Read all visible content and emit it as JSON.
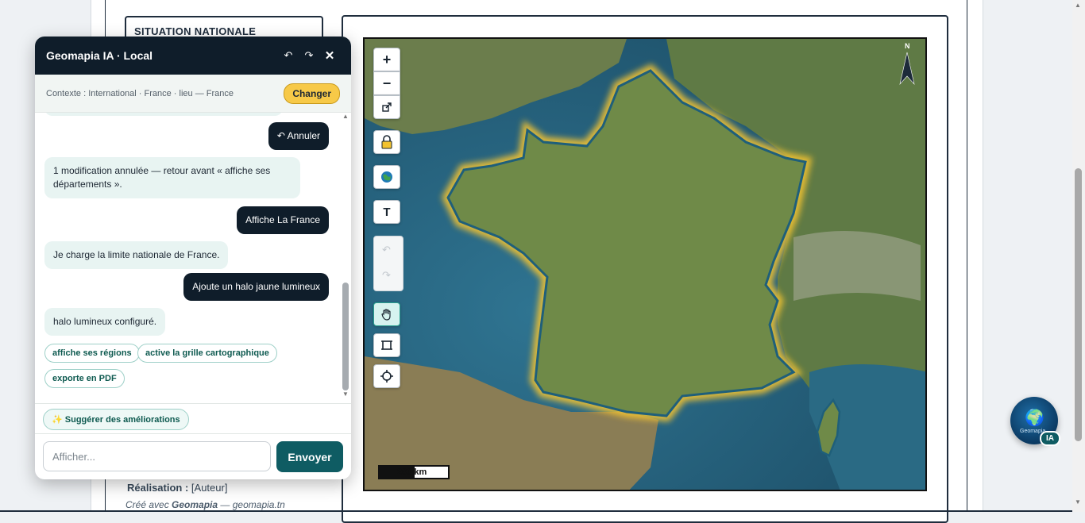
{
  "document": {
    "side_title": "SITUATION NATIONALE",
    "credit_label": "Réalisation :",
    "credit_value": "[Auteur]",
    "made_with_prefix": "Créé avec",
    "made_with_brand": "Geomapia",
    "made_with_suffix": "— geomapia.tn"
  },
  "map": {
    "zoom_in": "+",
    "zoom_out": "−",
    "text_tool": "T",
    "scale_label": "200 km",
    "north_label": "N",
    "tools": [
      "zoom-in",
      "zoom-out",
      "open-external",
      "lock",
      "basemap-globe",
      "text",
      "undo",
      "redo",
      "pan-hand",
      "frame",
      "locate"
    ],
    "colors": {
      "halo": "#f2c230",
      "border": "#1f5f7a",
      "sea": "#2d6c86",
      "land": "#6b8a4a"
    }
  },
  "chat": {
    "title": "Geomapia IA · Local",
    "context": "Contexte : International · France · lieu — France",
    "change_label": "Changer",
    "messages": [
      {
        "role": "user",
        "text": "↶ Annuler"
      },
      {
        "role": "bot",
        "text": "1 modification annulée — retour avant « affiche ses départements »."
      },
      {
        "role": "user",
        "text": "Affiche La France"
      },
      {
        "role": "bot",
        "text": "Je charge la limite nationale de France."
      },
      {
        "role": "user",
        "text": "Ajoute un halo jaune lumineux"
      },
      {
        "role": "bot",
        "text": "halo lumineux configuré."
      }
    ],
    "chips": [
      "affiche ses régions",
      "active la grille cartographique",
      "exporte en PDF"
    ],
    "suggest_label": "Suggérer des améliorations",
    "input_placeholder": "Afficher...",
    "send_label": "Envoyer"
  },
  "fab": {
    "badge": "IA",
    "small_text": "Geomapia"
  }
}
